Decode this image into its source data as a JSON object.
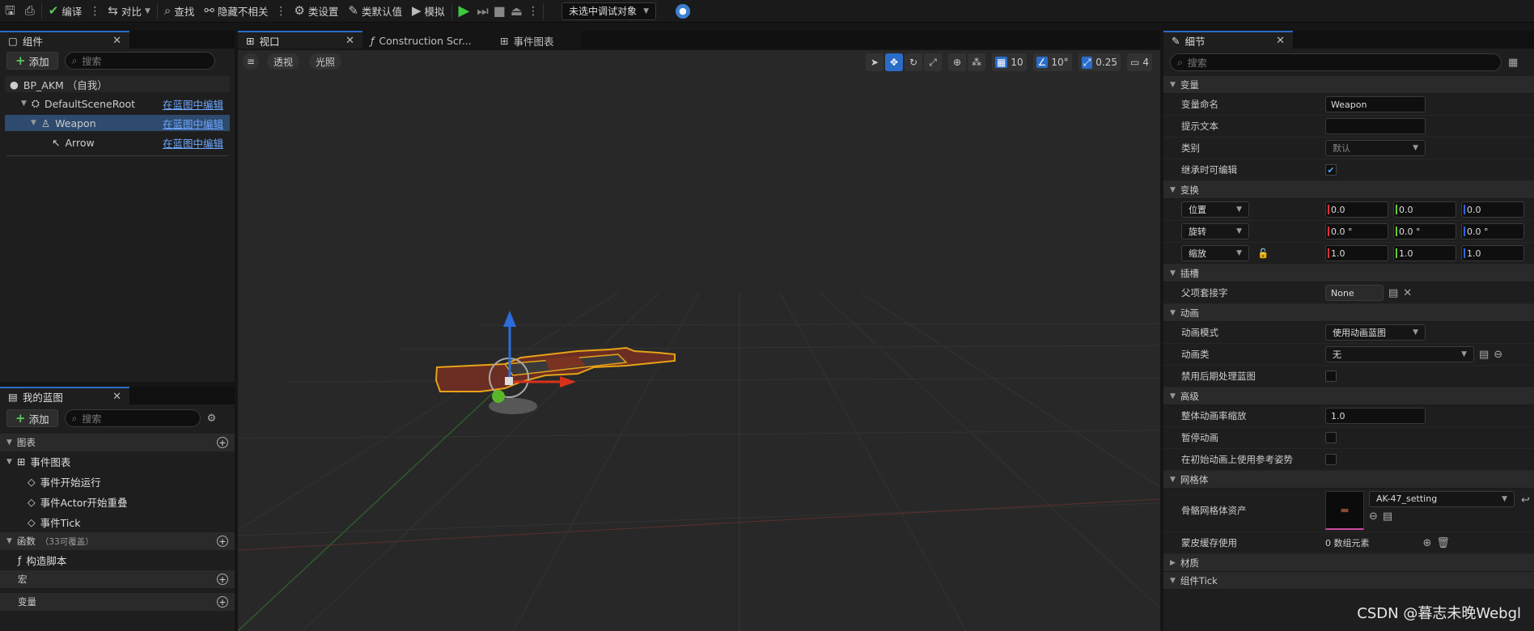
{
  "toolbar": {
    "compile": "编译",
    "diff": "对比",
    "find": "查找",
    "hide_unrelated": "隐藏不相关",
    "class_settings": "类设置",
    "class_defaults": "类默认值",
    "simulate": "模拟",
    "debug_object": "未选中调试对象"
  },
  "components": {
    "tab_label": "组件",
    "add_label": "添加",
    "search_placeholder": "搜索",
    "root": "BP_AKM （自我）",
    "edit_link": "在蓝图中编辑",
    "items": [
      {
        "label": "DefaultSceneRoot"
      },
      {
        "label": "Weapon"
      },
      {
        "label": "Arrow"
      }
    ]
  },
  "my_blueprint": {
    "tab_label": "我的蓝图",
    "add_label": "添加",
    "search_placeholder": "搜索",
    "graphs_header": "图表",
    "event_graph": "事件图表",
    "events": [
      "事件开始运行",
      "事件Actor开始重叠",
      "事件Tick"
    ],
    "functions_header": "函数",
    "functions_note": "（33可覆盖）",
    "construction_script": "构造脚本",
    "macros_header": "宏",
    "variables_header": "变量"
  },
  "tabs": {
    "viewport": "视口",
    "construction": "Construction Scr...",
    "event_graph": "事件图表"
  },
  "viewport": {
    "perspective": "透视",
    "lit": "光照",
    "grid_snap": "10",
    "rot_snap": "10°",
    "scale_snap": "0.25",
    "camera_speed": "4"
  },
  "details": {
    "tab_label": "细节",
    "search_placeholder": "搜索",
    "sections": {
      "variable": "变量",
      "transform": "变换",
      "socket": "插槽",
      "animation": "动画",
      "advanced": "高级",
      "mesh": "网格体",
      "materials": "材质",
      "component_tick": "组件Tick"
    },
    "variable_name_label": "变量命名",
    "variable_name_value": "Weapon",
    "tooltip_label": "提示文本",
    "category_label": "类别",
    "category_value": "默认",
    "editable_label": "继承时可编辑",
    "location_label": "位置",
    "rotation_label": "旋转",
    "scale_label": "缩放",
    "location": [
      "0.0",
      "0.0",
      "0.0"
    ],
    "rotation": [
      "0.0 °",
      "0.0 °",
      "0.0 °"
    ],
    "scale": [
      "1.0",
      "1.0",
      "1.0"
    ],
    "parent_socket_label": "父项套接字",
    "parent_socket_value": "None",
    "anim_mode_label": "动画模式",
    "anim_mode_value": "使用动画蓝图",
    "anim_class_label": "动画类",
    "anim_class_value": "无",
    "disable_post_label": "禁用后期处理蓝图",
    "global_rate_label": "整体动画率缩放",
    "global_rate_value": "1.0",
    "pause_label": "暂停动画",
    "ref_pose_label": "在初始动画上使用参考姿势",
    "skeletal_mesh_label": "骨骼网格体资产",
    "skeletal_mesh_value": "AK-47_setting",
    "skin_cache_label": "蒙皮缓存使用",
    "skin_cache_value": "0 数组元素"
  },
  "watermark": "CSDN @暮志未晚Webgl"
}
